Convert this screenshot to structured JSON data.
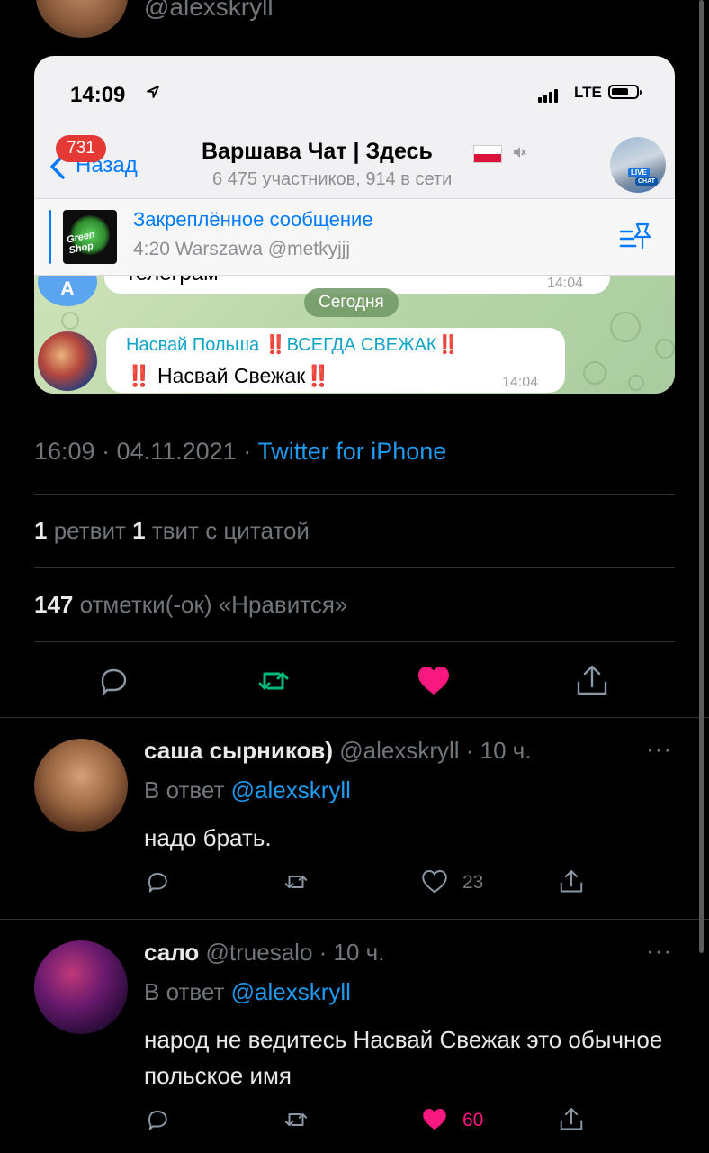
{
  "top": {
    "handle": "@alexskryll"
  },
  "embedded_screenshot": {
    "status_time": "14:09",
    "network": "LTE",
    "back_badge": "731",
    "back_label": "Назад",
    "chat_title": "Варшава Чат | Здесь",
    "chat_subtitle": "6 475 участников, 914 в сети",
    "avatar_tags": [
      "LIVE",
      "CHAT"
    ],
    "pinned_title": "Закреплённое сообщение",
    "pinned_text": "4:20 Warszawa @metkyjjj",
    "pinned_thumb_text": "Green Shop",
    "prev_message_text": "телеграм",
    "prev_message_time": "14:04",
    "prev_avatar_letter": "А",
    "date_pill": "Сегодня",
    "message": {
      "sender_name": "Насвай Польша ",
      "sender_suffix": "ВСЕГДА СВЕЖАК",
      "text": "Насвай Свежак",
      "bang": "‼️",
      "time": "14:04"
    }
  },
  "tweet": {
    "time_date": "16:09 · 04.11.2021 · ",
    "source": "Twitter for iPhone",
    "retweets_count": "1",
    "retweets_label": " ретвит ",
    "quotes_count": "1",
    "quotes_label": " твит с цитатой",
    "likes_count": "147",
    "likes_label": " отметки(-ок) «Нравится»"
  },
  "replies": [
    {
      "name": "саша сырников)",
      "handle": " @alexskryll · 10 ч.",
      "reply_prefix": "В ответ ",
      "reply_to": "@alexskryll",
      "text": "надо брать.",
      "like_count": "23",
      "liked": false,
      "more": "···"
    },
    {
      "name": "сало",
      "handle": " @truesalo · 10 ч.",
      "reply_prefix": "В ответ ",
      "reply_to": "@alexskryll",
      "text": "народ не ведитесь Насвай Свежак это обычное польское имя",
      "like_count": "60",
      "liked": true,
      "more": "···"
    }
  ],
  "colors": {
    "accent": "#1d9bf0",
    "like": "#f91880",
    "retweet": "#00ba7c",
    "muted": "#71767b"
  }
}
